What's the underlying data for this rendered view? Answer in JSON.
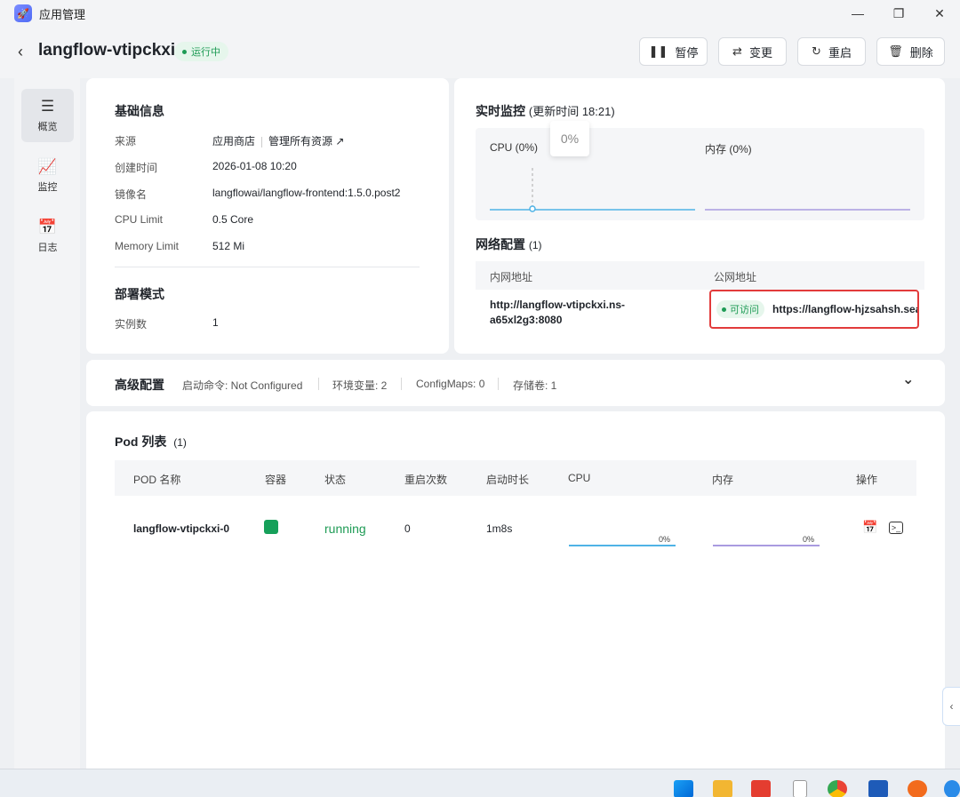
{
  "app": {
    "title": "应用管理"
  },
  "header": {
    "back": "‹",
    "title": "langflow-vtipckxi",
    "status": "运行中",
    "buttons": {
      "pause": "暂停",
      "change": "变更",
      "restart": "重启",
      "delete": "删除"
    }
  },
  "sidebar": {
    "items": [
      {
        "label": "概览",
        "icon": "server-icon",
        "active": true
      },
      {
        "label": "监控",
        "icon": "chart-icon",
        "active": false
      },
      {
        "label": "日志",
        "icon": "calendar-log-icon",
        "active": false
      }
    ]
  },
  "basic_info": {
    "title": "基础信息",
    "source_label": "来源",
    "source_value": "应用商店",
    "source_link": "管理所有资源 ↗",
    "created_label": "创建时间",
    "created_value": "2026-01-08 10:20",
    "image_label": "镜像名",
    "image_value": "langflowai/langflow-frontend:1.5.0.post2",
    "cpu_label": "CPU Limit",
    "cpu_value": "0.5 Core",
    "mem_label": "Memory Limit",
    "mem_value": "512 Mi"
  },
  "deploy": {
    "title": "部署模式",
    "instances_label": "实例数",
    "instances_value": "1"
  },
  "monitor": {
    "title": "实时监控",
    "update": "(更新时间  18:21)",
    "cpu_label": "CPU  (0%)",
    "mem_label": "内存  (0%)",
    "tooltip": "0%",
    "cpu_color": "#4fb3e6",
    "mem_color": "#a99be0"
  },
  "network": {
    "title": "网络配置",
    "count": "(1)",
    "col_internal": "内网地址",
    "col_public": "公网地址",
    "internal_line1": "http://langflow-vtipckxi.ns-",
    "internal_line2": "a65xl2g3:8080",
    "access": "可访问",
    "public_url": "https://langflow-hjzsahsh.sea"
  },
  "advanced": {
    "title": "高级配置",
    "cmd": "启动命令: Not Configured",
    "env": "环境变量: 2",
    "configmaps": "ConfigMaps: 0",
    "storage": "存储卷: 1",
    "chevron": "⌄"
  },
  "pods": {
    "title": "Pod 列表",
    "count": "(1)",
    "columns": [
      "POD 名称",
      "容器",
      "状态",
      "重启次数",
      "启动时长",
      "CPU",
      "内存",
      "操作"
    ],
    "rows": [
      {
        "name": "langflow-vtipckxi-0",
        "container_color": "#16a05a",
        "status": "running",
        "restarts": "0",
        "uptime": "1m8s",
        "cpu_pct": "0%",
        "mem_pct": "0%"
      }
    ]
  },
  "side_tab": "‹"
}
